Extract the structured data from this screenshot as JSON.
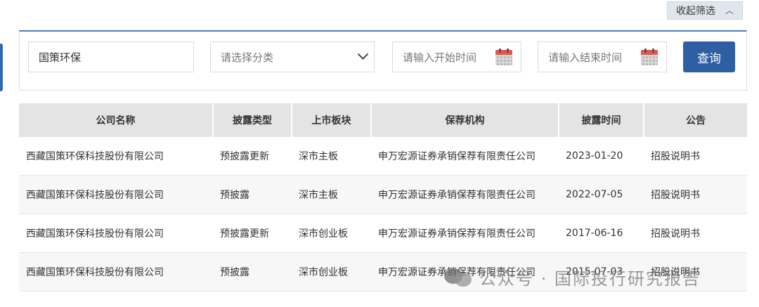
{
  "filters": {
    "collapse_label": "收起筛选",
    "company_value": "国策环保",
    "category_placeholder": "请选择分类",
    "start_placeholder": "请输入开始时间",
    "end_placeholder": "请输入结束时间",
    "search_label": "查询"
  },
  "table": {
    "headers": [
      "公司名称",
      "披露类型",
      "上市板块",
      "保荐机构",
      "披露时间",
      "公告"
    ],
    "rows": [
      [
        "西藏国策环保科技股份有限公司",
        "预披露更新",
        "深市主板",
        "申万宏源证券承销保荐有限责任公司",
        "2023-01-20",
        "招股说明书"
      ],
      [
        "西藏国策环保科技股份有限公司",
        "预披露",
        "深市主板",
        "申万宏源证券承销保荐有限责任公司",
        "2022-07-05",
        "招股说明书"
      ],
      [
        "西藏国策环保科技股份有限公司",
        "预披露更新",
        "深市创业板",
        "申万宏源证券承销保荐有限责任公司",
        "2017-06-16",
        "招股说明书"
      ],
      [
        "西藏国策环保科技股份有限公司",
        "预披露",
        "深市创业板",
        "申万宏源证券承销保荐有限责任公司",
        "2015-07-03",
        "招股说明书"
      ]
    ]
  },
  "watermark": {
    "text": "公众号 · 国际投行研究报告"
  },
  "colors": {
    "accent": "#2e5fa3",
    "header_bg": "#e4e4e4",
    "calendar_red": "#e2574c"
  }
}
